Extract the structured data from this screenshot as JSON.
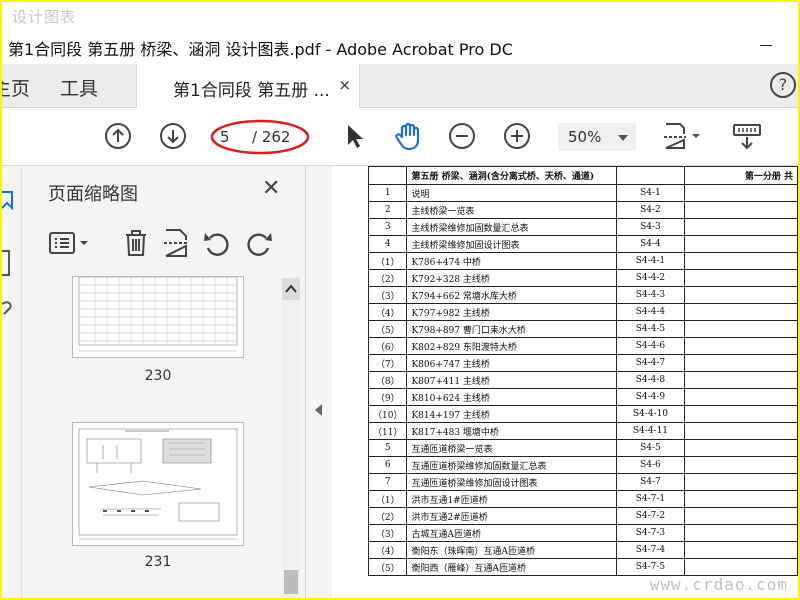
{
  "watermark": "设计图表",
  "window": {
    "title": "第1合同段 第五册 桥梁、涵洞 设计图表.pdf - Adobe Acrobat Pro DC"
  },
  "tabs": {
    "home": "主页",
    "tools": "工具",
    "document": "第1合同段 第五册 ...",
    "close": "×"
  },
  "toolbar": {
    "page_current": "5",
    "page_total": "/ 262",
    "zoom": "50%",
    "annotation_color": "#d42020"
  },
  "panel": {
    "title": "页面缩略图",
    "close": "✕",
    "thumbnails": [
      {
        "number": "230"
      },
      {
        "number": "231"
      }
    ]
  },
  "document": {
    "header": {
      "col1": "",
      "col2": "第五册  桥梁、涵洞(含分离式桥、天桥、通道)",
      "col3": "",
      "col4": "第一分册  共"
    },
    "rows": [
      {
        "no": "1",
        "name": "说明",
        "code": "S4-1"
      },
      {
        "no": "2",
        "name": "主线桥梁一览表",
        "code": "S4-2"
      },
      {
        "no": "3",
        "name": "主线桥梁维修加固数量汇总表",
        "code": "S4-3"
      },
      {
        "no": "4",
        "name": "主线桥梁维修加固设计图表",
        "code": "S4-4"
      },
      {
        "no": "（1）",
        "name": "K786+474 中桥",
        "code": "S4-4-1"
      },
      {
        "no": "（2）",
        "name": "K792+328 主线桥",
        "code": "S4-4-2"
      },
      {
        "no": "（3）",
        "name": "K794+662 常塘水库大桥",
        "code": "S4-4-3"
      },
      {
        "no": "（4）",
        "name": "K797+982 主线桥",
        "code": "S4-4-4"
      },
      {
        "no": "（5）",
        "name": "K798+897 曹门口耒水大桥",
        "code": "S4-4-5"
      },
      {
        "no": "（6）",
        "name": "K802+829 东阳渡特大桥",
        "code": "S4-4-6"
      },
      {
        "no": "（7）",
        "name": "K806+747 主线桥",
        "code": "S4-4-7"
      },
      {
        "no": "（8）",
        "name": "K807+411 主线桥",
        "code": "S4-4-8"
      },
      {
        "no": "（9）",
        "name": "K810+624 主线桥",
        "code": "S4-4-9"
      },
      {
        "no": "（10）",
        "name": "K814+197 主线桥",
        "code": "S4-4-10"
      },
      {
        "no": "（11）",
        "name": "K817+483 堰塘中桥",
        "code": "S4-4-11"
      },
      {
        "no": "5",
        "name": "互通匝道桥梁一览表",
        "code": "S4-5"
      },
      {
        "no": "6",
        "name": "互通匝道桥梁维修加固数量汇总表",
        "code": "S4-6"
      },
      {
        "no": "7",
        "name": "互通匝道桥梁维修加固设计图表",
        "code": "S4-7"
      },
      {
        "no": "（1）",
        "name": "洪市互通1#匝道桥",
        "code": "S4-7-1"
      },
      {
        "no": "（2）",
        "name": "洪市互通2#匝道桥",
        "code": "S4-7-2"
      },
      {
        "no": "（3）",
        "name": "古城互通A匝道桥",
        "code": "S4-7-3"
      },
      {
        "no": "（4）",
        "name": "衡阳东（珠晖南）互通A匝道桥",
        "code": "S4-7-4"
      },
      {
        "no": "（5）",
        "name": "衡阳西（雁峰）互通A匝道桥",
        "code": "S4-7-5"
      }
    ]
  },
  "site_mark": "www.crdao.com"
}
